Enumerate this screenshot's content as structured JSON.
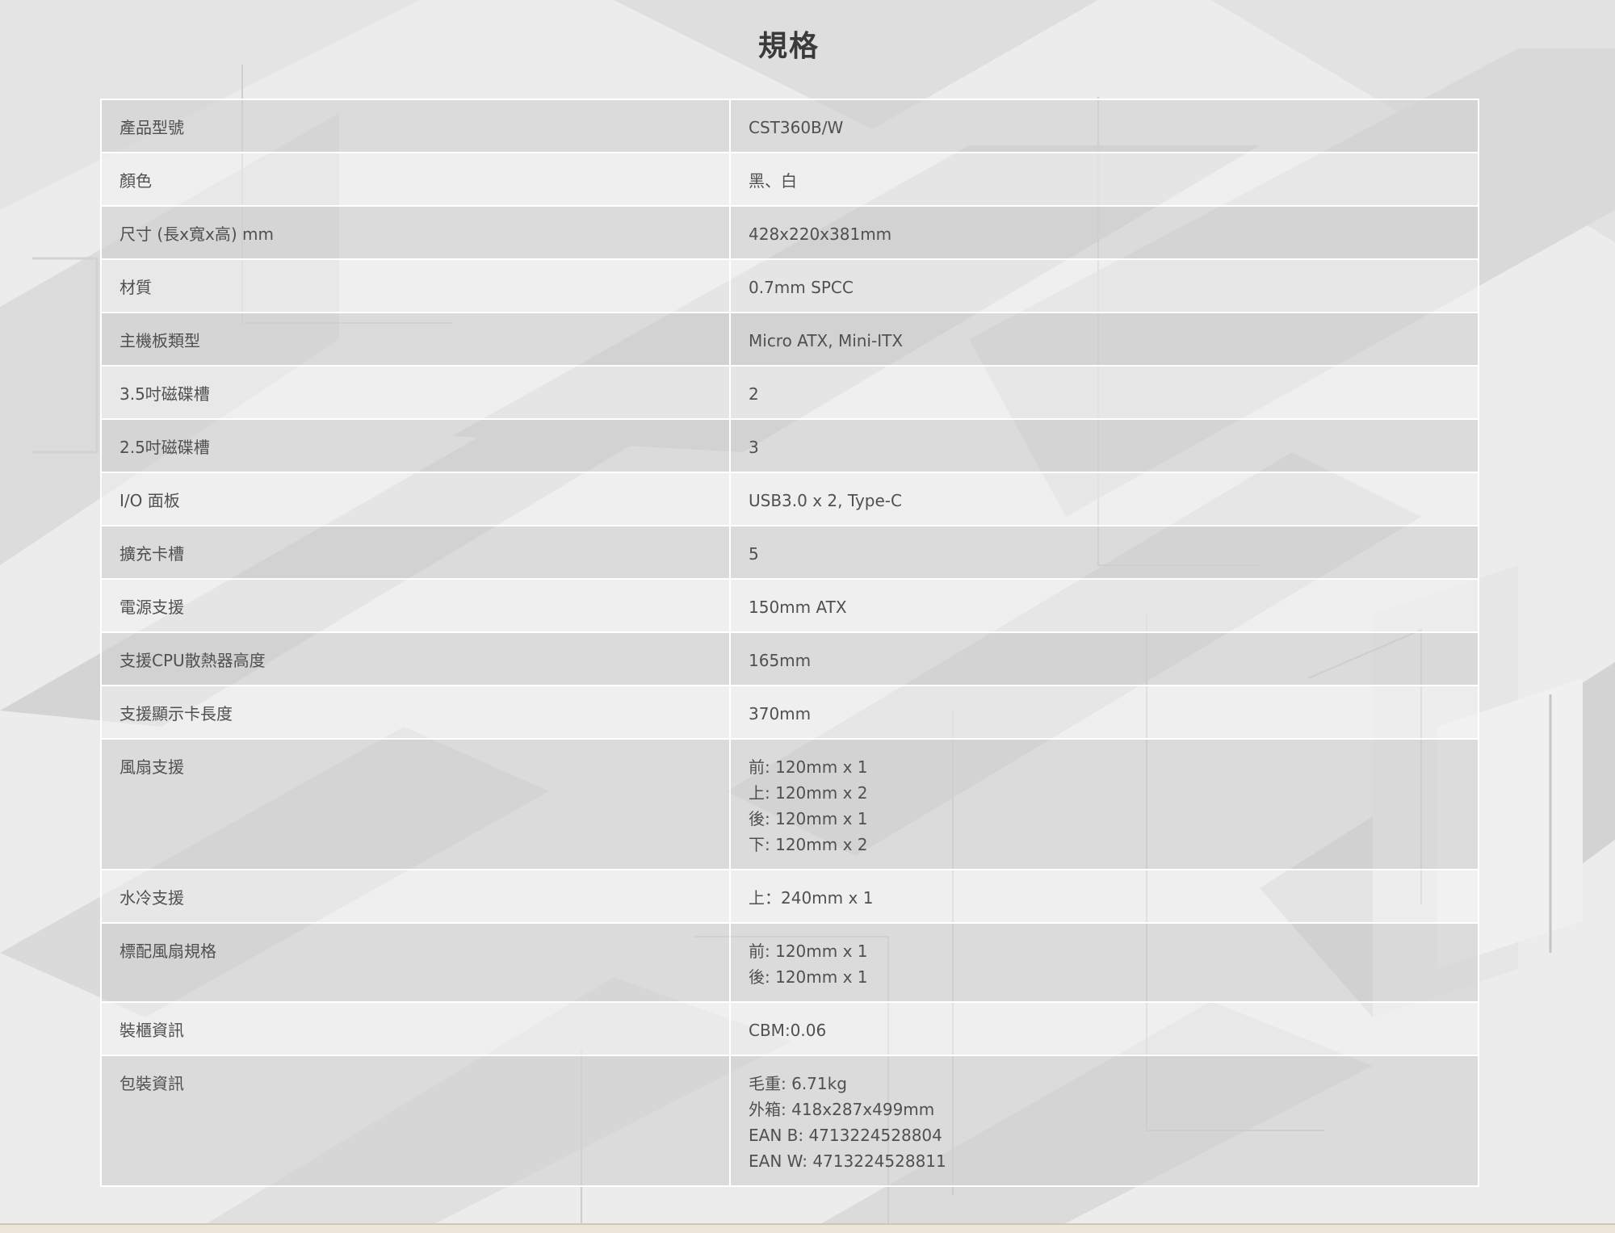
{
  "page": {
    "title": "規格"
  },
  "specs": [
    {
      "label": "產品型號",
      "values": [
        "CST360B/W"
      ]
    },
    {
      "label": "顏色",
      "values": [
        "黑、白"
      ]
    },
    {
      "label": "尺寸 (長x寬x高) mm",
      "values": [
        "428x220x381mm"
      ]
    },
    {
      "label": "材質",
      "values": [
        "0.7mm SPCC"
      ]
    },
    {
      "label": "主機板類型",
      "values": [
        "Micro ATX, Mini-ITX"
      ]
    },
    {
      "label": "3.5吋磁碟槽",
      "values": [
        "2"
      ]
    },
    {
      "label": "2.5吋磁碟槽",
      "values": [
        "3"
      ]
    },
    {
      "label": "I/O 面板",
      "values": [
        "USB3.0 x 2, Type-C"
      ]
    },
    {
      "label": "擴充卡槽",
      "values": [
        "5"
      ]
    },
    {
      "label": "電源支援",
      "values": [
        "150mm ATX"
      ]
    },
    {
      "label": "支援CPU散熱器高度",
      "values": [
        "165mm"
      ]
    },
    {
      "label": "支援顯示卡長度",
      "values": [
        "370mm"
      ]
    },
    {
      "label": "風扇支援",
      "values": [
        "前: 120mm x 1",
        "上: 120mm x 2",
        "後: 120mm x 1",
        "下: 120mm x 2"
      ]
    },
    {
      "label": "水冷支援",
      "values": [
        "上：240mm x 1"
      ]
    },
    {
      "label": "標配風扇規格",
      "values": [
        "前: 120mm x 1",
        "後: 120mm x 1"
      ]
    },
    {
      "label": "裝櫃資訊",
      "values": [
        "CBM:0.06"
      ]
    },
    {
      "label": "包裝資訊",
      "values": [
        "毛重: 6.71kg",
        "外箱: 418x287x499mm",
        "EAN B: 4713224528804",
        "EAN W: 4713224528811"
      ]
    }
  ]
}
